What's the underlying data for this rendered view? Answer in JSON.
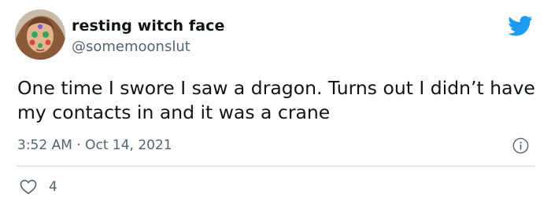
{
  "tweet": {
    "display_name": "resting witch face",
    "handle": "@somemoonslut",
    "text": "One time I swore I saw a dragon. Turns out I didn’t have my contacts in and it was a crane",
    "time": "3:52 AM",
    "separator": "·",
    "date": "Oct 14, 2021",
    "like_count": "4"
  },
  "icons": {
    "logo": "twitter-bird-icon",
    "info": "info-icon",
    "like": "heart-icon"
  },
  "colors": {
    "twitter_blue": "#1d9bf0",
    "secondary_text": "#536471",
    "divider": "#cfd9de"
  }
}
